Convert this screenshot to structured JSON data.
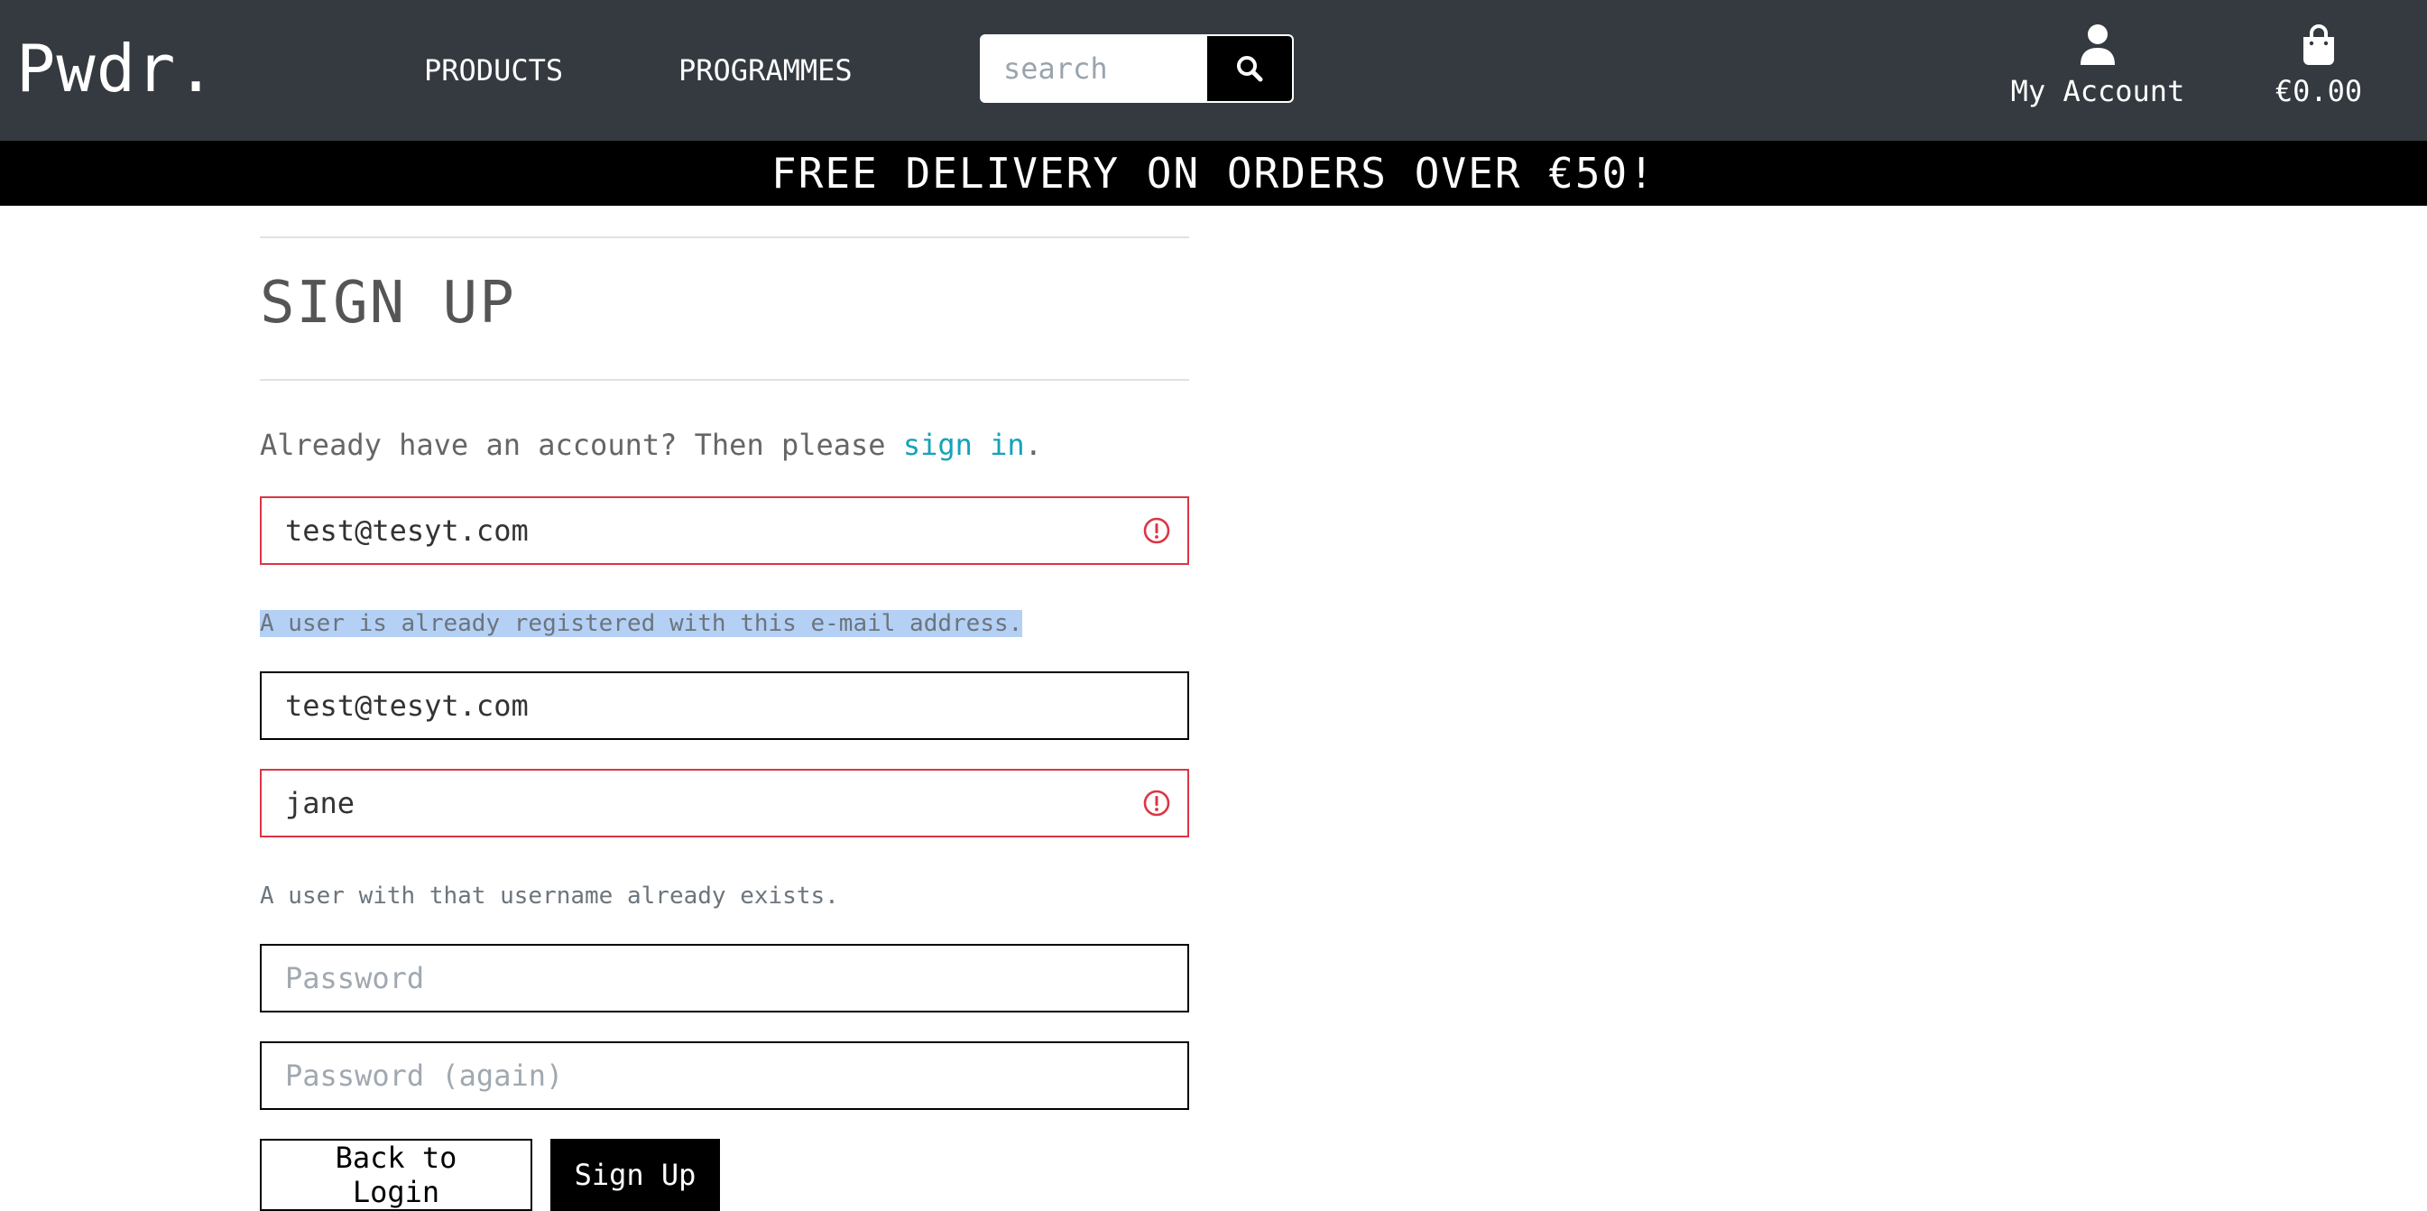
{
  "header": {
    "logo": "Pwdr.",
    "nav": {
      "products": "PRODUCTS",
      "programmes": "PROGRAMMES"
    },
    "search": {
      "placeholder": "search",
      "button_icon": "search-icon"
    },
    "account": {
      "label": "My Account",
      "icon": "user-icon"
    },
    "bag": {
      "total": "€0.00",
      "icon": "shopping-bag-icon"
    }
  },
  "banner": {
    "text": "FREE DELIVERY ON ORDERS OVER €50!"
  },
  "form": {
    "title": "SIGN UP",
    "signin_prompt": "Already have an account? Then please ",
    "signin_link": "sign in",
    "signin_suffix": ".",
    "email": {
      "value": "test@tesyt.com",
      "error": "A user is already registered with this e-mail address.",
      "error_icon": "exclamation-circle-icon"
    },
    "email_confirm": {
      "value": "test@tesyt.com"
    },
    "username": {
      "value": "jane",
      "error": "A user with that username already exists.",
      "error_icon": "exclamation-circle-icon"
    },
    "password": {
      "placeholder": "Password"
    },
    "password_confirm": {
      "placeholder": "Password (again)"
    },
    "buttons": {
      "back": "Back to Login",
      "signup": "Sign Up"
    }
  },
  "colors": {
    "header_bg": "#343a40",
    "banner_bg": "#000000",
    "link": "#17a2b8",
    "error": "#dc3545",
    "selection": "#b4d0f5"
  }
}
